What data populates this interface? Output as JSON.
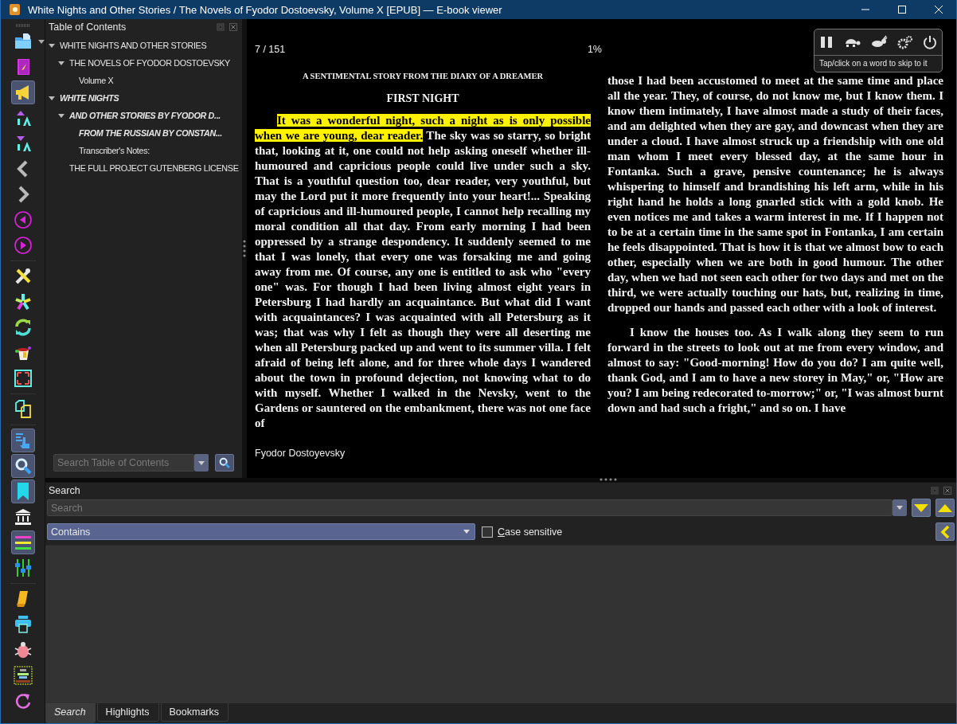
{
  "window": {
    "title": "White Nights and Other Stories / The Novels of Fyodor Dostoevsky, Volume X [EPUB] — E-book viewer"
  },
  "toolbar": [
    {
      "kind": "button",
      "selected": false
    },
    {
      "kind": "button",
      "selected": false
    },
    {
      "kind": "button",
      "selected": true
    },
    {
      "kind": "button",
      "selected": false
    },
    {
      "kind": "button",
      "selected": false
    },
    {
      "kind": "button",
      "selected": false
    },
    {
      "kind": "button",
      "selected": false
    },
    {
      "kind": "button",
      "selected": false
    },
    {
      "kind": "button",
      "selected": false
    },
    {
      "kind": "separator"
    },
    {
      "kind": "button",
      "selected": false
    },
    {
      "kind": "button",
      "selected": false
    },
    {
      "kind": "button",
      "selected": false
    },
    {
      "kind": "button",
      "selected": false
    },
    {
      "kind": "button",
      "selected": false
    },
    {
      "kind": "separator"
    },
    {
      "kind": "button",
      "selected": false
    },
    {
      "kind": "separator"
    },
    {
      "kind": "button",
      "selected": true
    },
    {
      "kind": "button",
      "selected": true
    },
    {
      "kind": "button",
      "selected": true
    },
    {
      "kind": "button",
      "selected": false
    },
    {
      "kind": "button",
      "selected": true
    },
    {
      "kind": "button",
      "selected": false
    },
    {
      "kind": "separator"
    },
    {
      "kind": "button",
      "selected": false
    },
    {
      "kind": "button",
      "selected": false
    },
    {
      "kind": "button",
      "selected": false
    },
    {
      "kind": "button",
      "selected": false
    },
    {
      "kind": "button",
      "selected": false
    }
  ],
  "toc": {
    "title": "Table of Contents",
    "search_placeholder": "Search Table of Contents",
    "items": [
      {
        "label": "WHITE NIGHTS AND OTHER STORIES",
        "emphasized": false,
        "expanded": true,
        "children": [
          {
            "label": "THE NOVELS OF FYODOR DOSTOEVSKY",
            "emphasized": false,
            "expanded": true,
            "children": [
              {
                "label": "Volume X",
                "emphasized": false
              }
            ]
          }
        ]
      },
      {
        "label": "WHITE NIGHTS",
        "emphasized": true,
        "expanded": true,
        "children": [
          {
            "label": "AND OTHER STORIES BY FYODOR D...",
            "emphasized": true,
            "expanded": true,
            "children": [
              {
                "label": "FROM THE RUSSIAN BY CONSTAN...",
                "emphasized": true
              },
              {
                "label": "Transcriber's Notes:",
                "emphasized": false
              }
            ]
          },
          {
            "label": "THE FULL PROJECT GUTENBERG LICENSE",
            "emphasized": false
          }
        ]
      }
    ]
  },
  "reader": {
    "position": "7 / 151",
    "percent": "1%",
    "subtitle": "A SENTIMENTAL STORY FROM THE DIARY OF A DREAMER",
    "heading": "FIRST NIGHT",
    "footer": "Fyodor Dostoyevsky",
    "left_column": [
      {
        "indent": true,
        "highlighted": "It was a wonderful night, such a night as is only possible when we are young, dear reader.",
        "text": " The sky was so starry, so bright that, looking at it, one could not help asking oneself whether ill-humoured and capricious people could live under such a sky. That is a youthful question too, dear reader, very youthful, but may the Lord put it more frequently into your heart!... Speaking of capricious and ill-humoured people, I cannot help recalling my moral condition all that day. From early morning I had been oppressed by a strange despondency. It suddenly seemed to me that I was lonely, that every one was forsaking me and going away from me. Of course, any one is entitled to ask who \"every one\" was. For though I had been living almost eight years in Petersburg I had hardly an acquaintance. But what did I want with acquaintances? I was acquainted with all Petersburg as it was; that was why I felt as though they were all deserting me when all Petersburg packed up and went to its summer villa. I felt afraid of being left alone, and for three whole days I wandered about the town in profound dejection, not knowing what to do with myself. Whether I walked in the Nevsky, went to the Gardens or sauntered on the embankment, there was not one face of"
      }
    ],
    "right_column": [
      {
        "indent": false,
        "text": "those I had been accustomed to meet at the same time and place all the year. They, of course, do not know me, but I know them. I know them intimately, I have almost made a study of their faces, and am delighted when they are gay, and downcast when they are under a cloud. I have almost struck up a friendship with one old man whom I meet every blessed day, at the same hour in Fontanka. Such a grave, pensive countenance; he is always whispering to himself and brandishing his left arm, while in his right hand he holds a long gnarled stick with a gold knob. He even notices me and takes a warm interest in me. If I happen not to be at a certain time in the same spot in Fontanka, I am certain he feels disappointed. That is how it is that we almost bow to each other, especially when we are both in good humour. The other day, when we had not seen each other for two days and met on the third, we were actually touching our hats, but, realizing in time, dropped our hands and passed each other with a look of interest."
      },
      {
        "indent": true,
        "text": "I know the houses too. As I walk along they seem to run forward in the streets to look out at me from every window, and almost to say: \"Good-morning! How do you do? I am quite well, thank God, and I am to have a new storey in May,\" or, \"How are you? I am being redecorated to-morrow;\" or, \"I was almost burnt down and had such a fright,\" and so on. I have"
      }
    ],
    "read_aloud": {
      "hint": "Tap/click on a word to skip to it"
    }
  },
  "search_panel": {
    "title": "Search",
    "placeholder": "Search",
    "mode": "Contains",
    "case_sensitive": {
      "label": "Case sensitive",
      "checked": false
    },
    "tabs": [
      {
        "label": "Search",
        "selected": true
      },
      {
        "label": "Highlights",
        "selected": false
      },
      {
        "label": "Bookmarks",
        "selected": false
      }
    ]
  }
}
